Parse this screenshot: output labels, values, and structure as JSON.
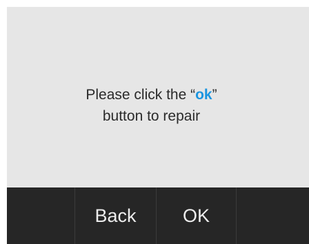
{
  "dialog": {
    "message_prefix": "Please click the “",
    "message_highlight": "ok",
    "message_suffix": "”",
    "message_line2": "button to repair",
    "highlight_color": "#1b95e0"
  },
  "footer": {
    "back_label": "Back",
    "ok_label": "OK"
  }
}
